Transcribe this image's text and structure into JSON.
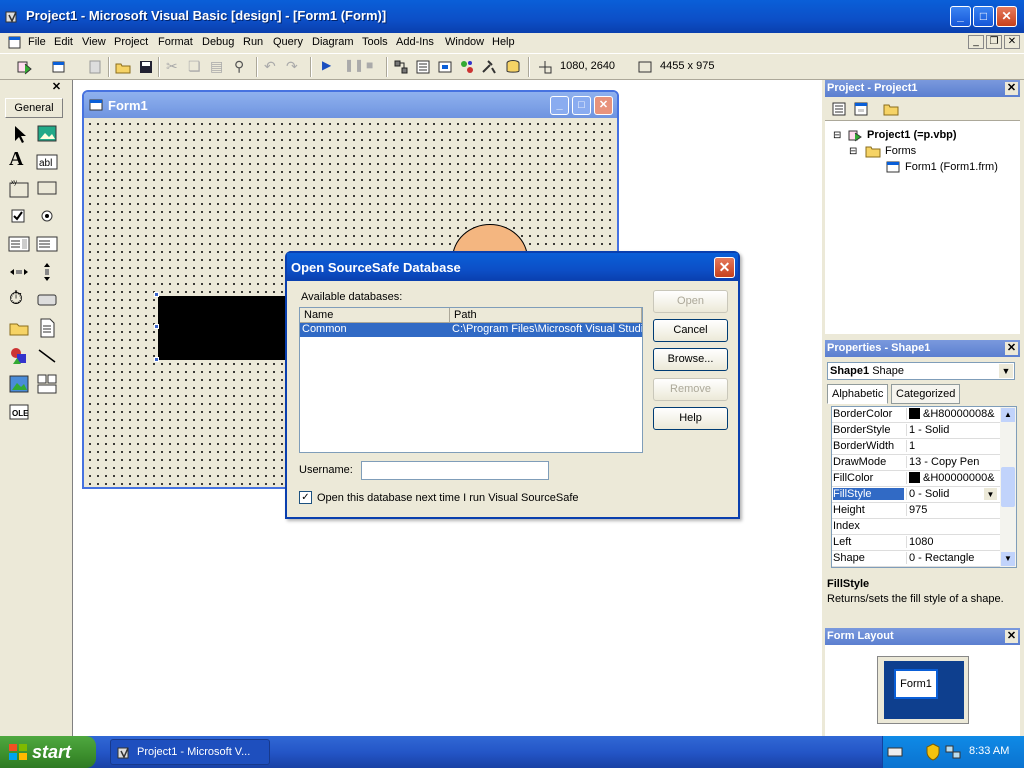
{
  "window": {
    "title": "Project1 - Microsoft Visual Basic [design] - [Form1 (Form)]"
  },
  "menu": [
    "File",
    "Edit",
    "View",
    "Project",
    "Format",
    "Debug",
    "Run",
    "Query",
    "Diagram",
    "Tools",
    "Add-Ins",
    "Window",
    "Help"
  ],
  "toolbar": {
    "position": "1080, 2640",
    "size": "4455 x 975"
  },
  "toolbox": {
    "tab": "General"
  },
  "form1": {
    "title": "Form1"
  },
  "project_panel": {
    "title": "Project - Project1",
    "tree": {
      "project": "Project1 (=p.vbp)",
      "folder": "Forms",
      "form": "Form1 (Form1.frm)"
    }
  },
  "properties_panel": {
    "title": "Properties - Shape1",
    "object_name": "Shape1",
    "object_type": "Shape",
    "tabs": [
      "Alphabetic",
      "Categorized"
    ],
    "rows": [
      {
        "name": "BorderColor",
        "value": "&H80000008&",
        "swatch": true
      },
      {
        "name": "BorderStyle",
        "value": "1 - Solid"
      },
      {
        "name": "BorderWidth",
        "value": "1"
      },
      {
        "name": "DrawMode",
        "value": "13 - Copy Pen"
      },
      {
        "name": "FillColor",
        "value": "&H00000000&",
        "swatch": true
      },
      {
        "name": "FillStyle",
        "value": "0 - Solid",
        "selected": true
      },
      {
        "name": "Height",
        "value": "975"
      },
      {
        "name": "Index",
        "value": ""
      },
      {
        "name": "Left",
        "value": "1080"
      },
      {
        "name": "Shape",
        "value": "0 - Rectangle"
      }
    ],
    "desc_title": "FillStyle",
    "desc_text": "Returns/sets the fill style of a shape."
  },
  "layout_panel": {
    "title": "Form Layout",
    "form_label": "Form1"
  },
  "dialog": {
    "title": "Open SourceSafe Database",
    "available_label": "Available databases:",
    "columns": [
      "Name",
      "Path"
    ],
    "rows": [
      {
        "name": "Common",
        "path": "C:\\Program Files\\Microsoft Visual Studio"
      }
    ],
    "username_label": "Username:",
    "username_value": "",
    "checkbox_label": "Open this database next time I run Visual SourceSafe",
    "buttons": {
      "open": "Open",
      "cancel": "Cancel",
      "browse": "Browse...",
      "remove": "Remove",
      "help": "Help"
    }
  },
  "taskbar": {
    "start": "start",
    "task": "Project1 - Microsoft V...",
    "time": "8:33 AM"
  },
  "colors": {
    "xp_blue": "#0a5fd8",
    "selection": "#316ac5",
    "start_green": "#3b8e2c"
  }
}
